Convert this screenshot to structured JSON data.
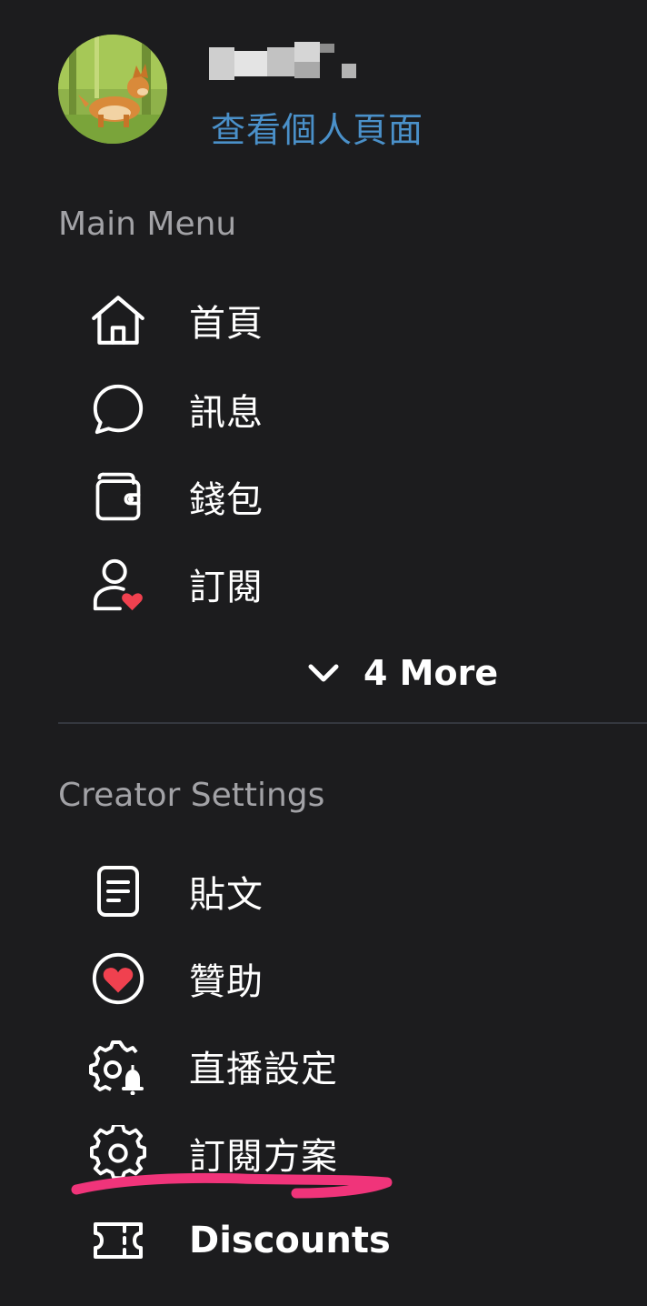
{
  "profile": {
    "view_profile_label": "查看個人頁面"
  },
  "main_menu": {
    "header": "Main Menu",
    "items": [
      {
        "label": "首頁",
        "icon": "home-icon"
      },
      {
        "label": "訊息",
        "icon": "chat-bubble-icon"
      },
      {
        "label": "錢包",
        "icon": "wallet-icon"
      },
      {
        "label": "訂閱",
        "icon": "user-heart-icon"
      }
    ],
    "more_label": "4 More"
  },
  "creator_settings": {
    "header": "Creator Settings",
    "items": [
      {
        "label": "貼文",
        "icon": "document-icon"
      },
      {
        "label": "贊助",
        "icon": "heart-circle-icon"
      },
      {
        "label": "直播設定",
        "icon": "gear-bell-icon"
      },
      {
        "label": "訂閱方案",
        "icon": "gear-icon"
      },
      {
        "label": "Discounts",
        "icon": "ticket-icon"
      }
    ]
  },
  "colors": {
    "background": "#1c1c1e",
    "link": "#4a90c9",
    "section_header": "#a2a2a6",
    "accent_red": "#f0414f",
    "annotation_pink": "#f0347a"
  }
}
